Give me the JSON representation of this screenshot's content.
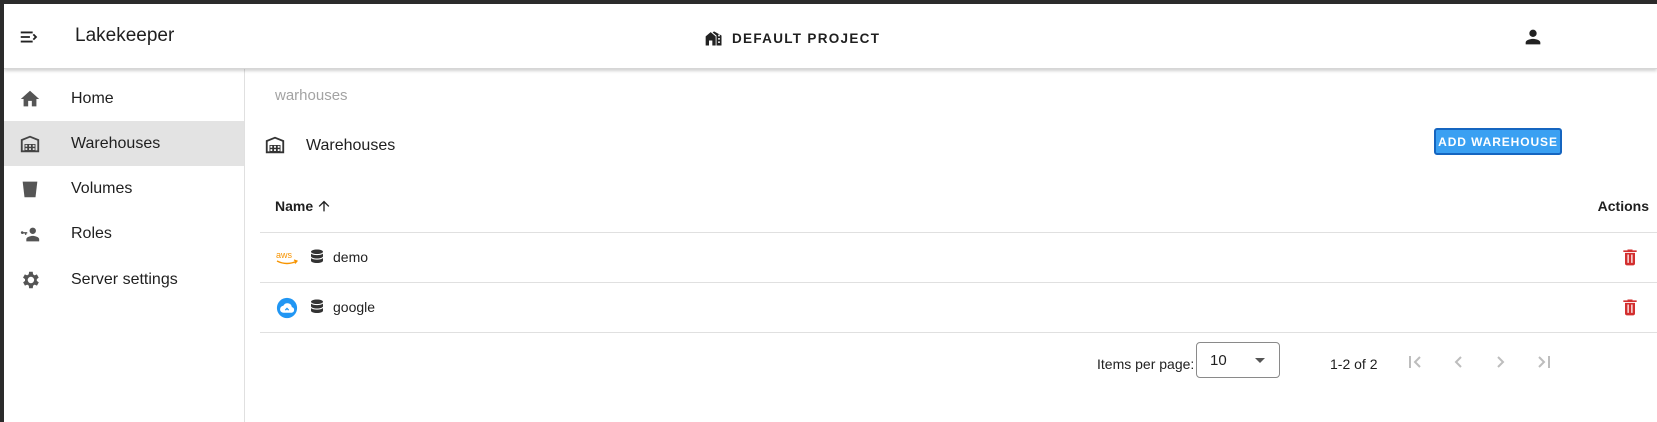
{
  "app": {
    "title": "Lakekeeper"
  },
  "header": {
    "project_label": "DEFAULT PROJECT"
  },
  "sidebar": {
    "items": [
      {
        "label": "Home",
        "icon": "home-icon"
      },
      {
        "label": "Warehouses",
        "icon": "warehouse-icon",
        "active": true
      },
      {
        "label": "Volumes",
        "icon": "bucket-icon"
      },
      {
        "label": "Roles",
        "icon": "account-key-icon"
      },
      {
        "label": "Server settings",
        "icon": "gear-icon"
      }
    ]
  },
  "main": {
    "breadcrumb": "warhouses",
    "section_title": "Warehouses",
    "add_button_label": "ADD WAREHOUSE",
    "table": {
      "columns": [
        "Name",
        "Actions"
      ],
      "sort": {
        "column": "Name",
        "direction": "ascending"
      },
      "rows": [
        {
          "name": "demo",
          "provider_icon": "aws-logo-icon"
        },
        {
          "name": "google",
          "provider_icon": "google-cloud-icon"
        }
      ]
    },
    "pagination": {
      "items_per_page_label": "Items per page:",
      "items_per_page": "10",
      "range": "1-2 of 2"
    }
  },
  "colors": {
    "accent": "#3aa0f2",
    "delete": "#d32f2f",
    "aws": "#f79400",
    "gcp": "#2196f3",
    "active_nav": "#e3e3e3"
  }
}
